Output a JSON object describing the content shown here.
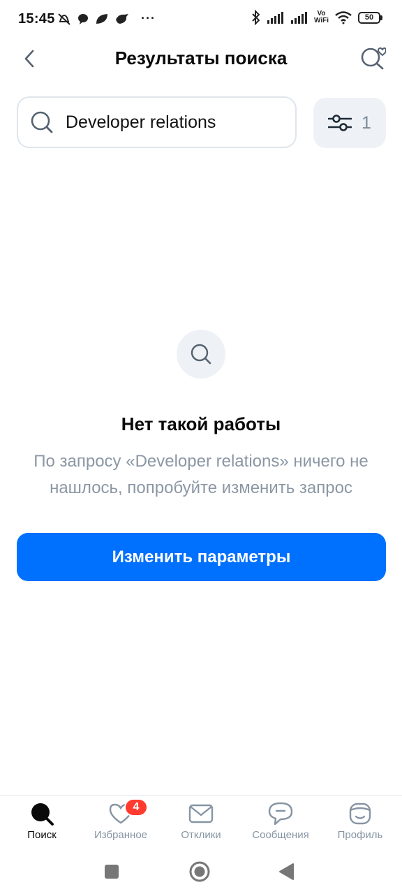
{
  "status_bar": {
    "time": "15:45",
    "battery": "50",
    "vowifi_top": "Vo",
    "vowifi_bottom": "WiFi"
  },
  "header": {
    "title": "Результаты поиска"
  },
  "search": {
    "value": "Developer relations",
    "placeholder": ""
  },
  "filter": {
    "count": "1"
  },
  "empty_state": {
    "title": "Нет такой работы",
    "description": "По запросу «Developer relations» ничего не нашлось, попробуйте изменить запрос"
  },
  "primary_action": {
    "label": "Изменить параметры"
  },
  "bottom_nav": {
    "items": [
      {
        "label": "Поиск",
        "icon": "search-icon",
        "active": true
      },
      {
        "label": "Избранное",
        "icon": "heart-icon",
        "badge": "4"
      },
      {
        "label": "Отклики",
        "icon": "envelope-icon"
      },
      {
        "label": "Сообщения",
        "icon": "chat-bubble-icon"
      },
      {
        "label": "Профиль",
        "icon": "profile-face-icon"
      }
    ]
  },
  "colors": {
    "accent": "#0070ff",
    "badge": "#ff3b30",
    "muted_text": "#8b97a4",
    "surface": "#eef2f6"
  }
}
